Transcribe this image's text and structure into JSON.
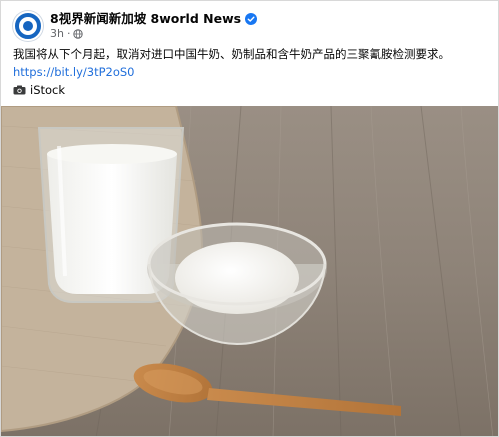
{
  "post": {
    "page_name": "8视界新闻新加坡 8world News",
    "time": "3h",
    "separator": "·",
    "text": "我国将从下个月起，取消对进口中国牛奶、奶制品和含牛奶产品的三聚氰胺检测要求。",
    "link": "https://bit.ly/3tP2oS0",
    "photo_credit": "iStock",
    "icons": {
      "avatar": "8world-logo-icon",
      "verified": "verified-badge-icon",
      "privacy": "globe-icon",
      "camera": "camera-icon"
    },
    "colors": {
      "link": "#216fdb",
      "verified": "#1877f2",
      "brand": "#1565c0"
    }
  }
}
